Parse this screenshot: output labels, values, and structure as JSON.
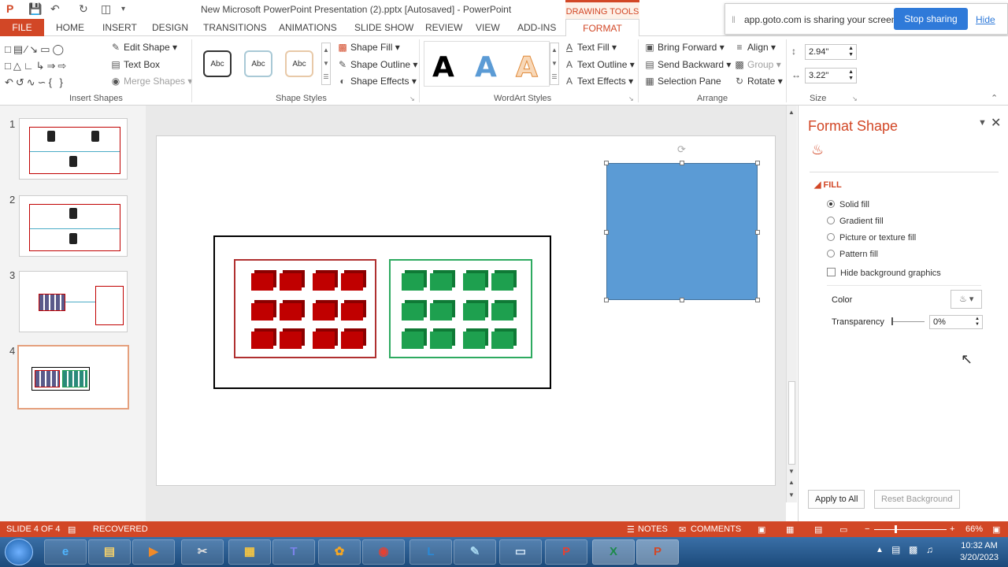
{
  "window": {
    "title": "New Microsoft PowerPoint Presentation (2).pptx [Autosaved] - PowerPoint",
    "contextual_tab_group": "DRAWING TOOLS"
  },
  "share_banner": {
    "text": "app.goto.com is sharing your screen.",
    "stop_label": "Stop sharing",
    "hide_label": "Hide"
  },
  "tabs": {
    "file": "FILE",
    "items": [
      "HOME",
      "INSERT",
      "DESIGN",
      "TRANSITIONS",
      "ANIMATIONS",
      "SLIDE SHOW",
      "REVIEW",
      "VIEW",
      "ADD-INS"
    ],
    "format": "FORMAT"
  },
  "ribbon": {
    "insert_shapes": {
      "label": "Insert Shapes",
      "edit_shape": "Edit Shape",
      "text_box": "Text Box",
      "merge_shapes": "Merge Shapes"
    },
    "shape_styles": {
      "label": "Shape Styles",
      "style_sample": "Abc",
      "shape_fill": "Shape Fill",
      "shape_outline": "Shape Outline",
      "shape_effects": "Shape Effects"
    },
    "wordart_styles": {
      "label": "WordArt Styles",
      "sample": "A",
      "text_fill": "Text Fill",
      "text_outline": "Text Outline",
      "text_effects": "Text Effects"
    },
    "arrange": {
      "label": "Arrange",
      "bring_forward": "Bring Forward",
      "send_backward": "Send Backward",
      "selection_pane": "Selection Pane",
      "align": "Align",
      "group": "Group",
      "rotate": "Rotate"
    },
    "size": {
      "label": "Size",
      "height": "2.94\"",
      "width": "3.22\""
    }
  },
  "slides": {
    "numbers": [
      "1",
      "2",
      "3",
      "4"
    ],
    "active": 4
  },
  "format_pane": {
    "title": "Format Shape",
    "section": "FILL",
    "options": [
      "Solid fill",
      "Gradient fill",
      "Picture or texture fill",
      "Pattern fill"
    ],
    "selected_option": "Solid fill",
    "hide_bg": "Hide background graphics",
    "color_label": "Color",
    "transparency_label": "Transparency",
    "transparency_value": "0%",
    "apply_all": "Apply to All",
    "reset_bg": "Reset Background"
  },
  "colors": {
    "accent": "#d24726",
    "shape_fill": "#5b9bd5",
    "red_box": "#c00000",
    "green_box": "#1ea04f"
  },
  "status": {
    "slide": "SLIDE 4 OF 4",
    "recovered": "RECOVERED",
    "notes": "NOTES",
    "comments": "COMMENTS",
    "zoom": "66%"
  },
  "taskbar": {
    "apps": [
      "start-orb",
      "ie",
      "explorer",
      "media",
      "snip",
      "folder",
      "teams",
      "app",
      "chrome",
      "lync",
      "notepad",
      "screen",
      "pdf",
      "excel",
      "powerpoint"
    ],
    "teams_glyph": "T",
    "lync_glyph": "L",
    "pdf_glyph": "P",
    "excel_glyph": "X",
    "ppt_glyph": "P",
    "time": "10:32 AM",
    "date": "3/20/2023"
  }
}
